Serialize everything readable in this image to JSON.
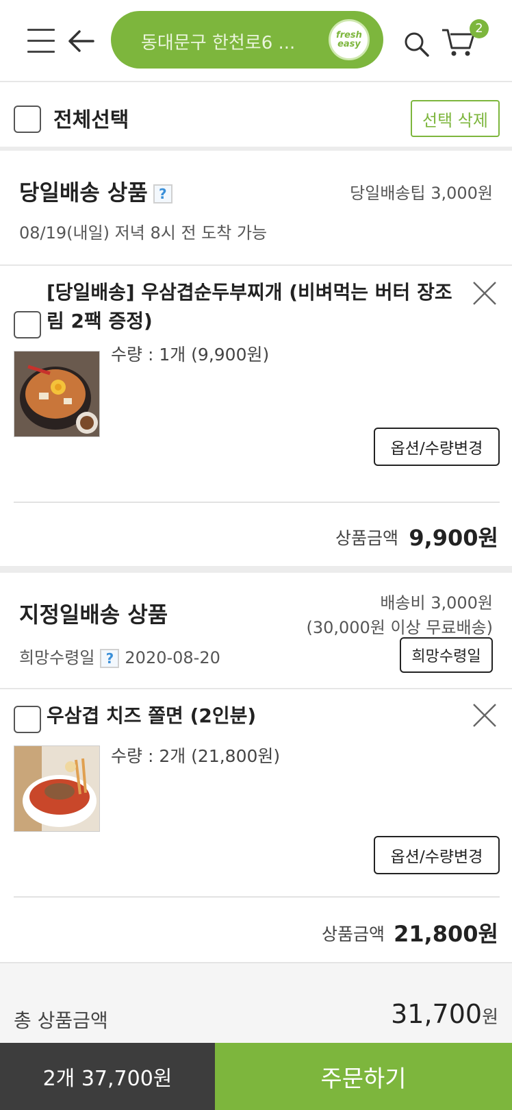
{
  "header": {
    "address": "동대문구 한천로6 ...",
    "logo_line1": "fresh",
    "logo_line2": "easy",
    "cart_count": "2"
  },
  "select_all": {
    "label": "전체선택",
    "delete_label": "선택 삭제"
  },
  "sections": [
    {
      "title": "당일배송 상품",
      "help": "?",
      "fee": "당일배송팁 3,000원",
      "sub": "08/19(내일) 저녁 8시 전 도착 가능",
      "item": {
        "name_line1": "[당일배송] 우삼겹순두부찌개 (비벼먹는 버터 장조",
        "name_line2": "림 2팩 증정)",
        "qty": "수량 : 1개 (9,900원)",
        "option_label": "옵션/수량변경",
        "subtotal_label": "상품금액",
        "subtotal_value": "9,900원"
      }
    },
    {
      "title": "지정일배송 상품",
      "fee_line1": "배송비 3,000원",
      "fee_line2": "(30,000원 이상 무료배송)",
      "date_label": "희망수령일",
      "help": "?",
      "date_value": "2020-08-20",
      "date_button": "희망수령일",
      "item": {
        "name_line1": "우삼겹 치즈 쫄면 (2인분)",
        "qty": "수량 : 2개 (21,800원)",
        "option_label": "옵션/수량변경",
        "subtotal_label": "상품금액",
        "subtotal_value": "21,800원"
      }
    }
  ],
  "total": {
    "label": "총 상품금액",
    "value": "31,700",
    "unit": "원"
  },
  "bottom": {
    "summary": "2개 37,700원",
    "order_label": "주문하기"
  },
  "colors": {
    "accent": "#7db63d",
    "dark": "#3d3d3d",
    "help_blue": "#3a8fd8"
  }
}
